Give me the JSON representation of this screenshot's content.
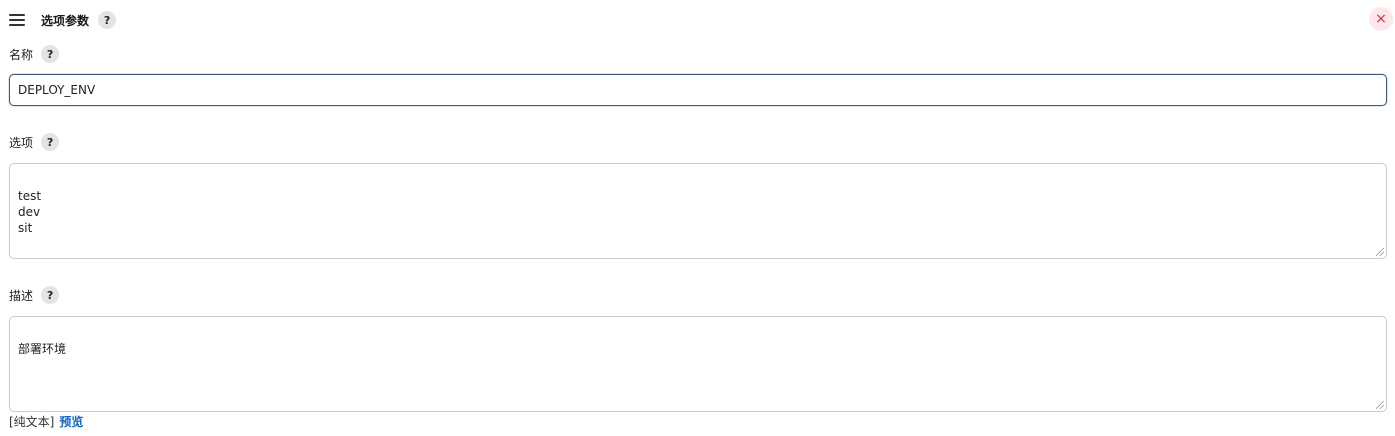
{
  "header": {
    "title": "选项参数",
    "help": "?",
    "close": "×"
  },
  "name_field": {
    "label": "名称",
    "help": "?",
    "value": "DEPLOY_ENV"
  },
  "choices_field": {
    "label": "选项",
    "help": "?",
    "value": "test\ndev\nsit"
  },
  "description_field": {
    "label": "描述",
    "help": "?",
    "value": "部署环境"
  },
  "footer": {
    "format": "[纯文本]",
    "preview": "预览"
  },
  "colors": {
    "accent_link": "#1565c0",
    "close_bg": "#fde7ea",
    "close_fg": "#d32f3f",
    "focused_border": "#3f5a72"
  }
}
